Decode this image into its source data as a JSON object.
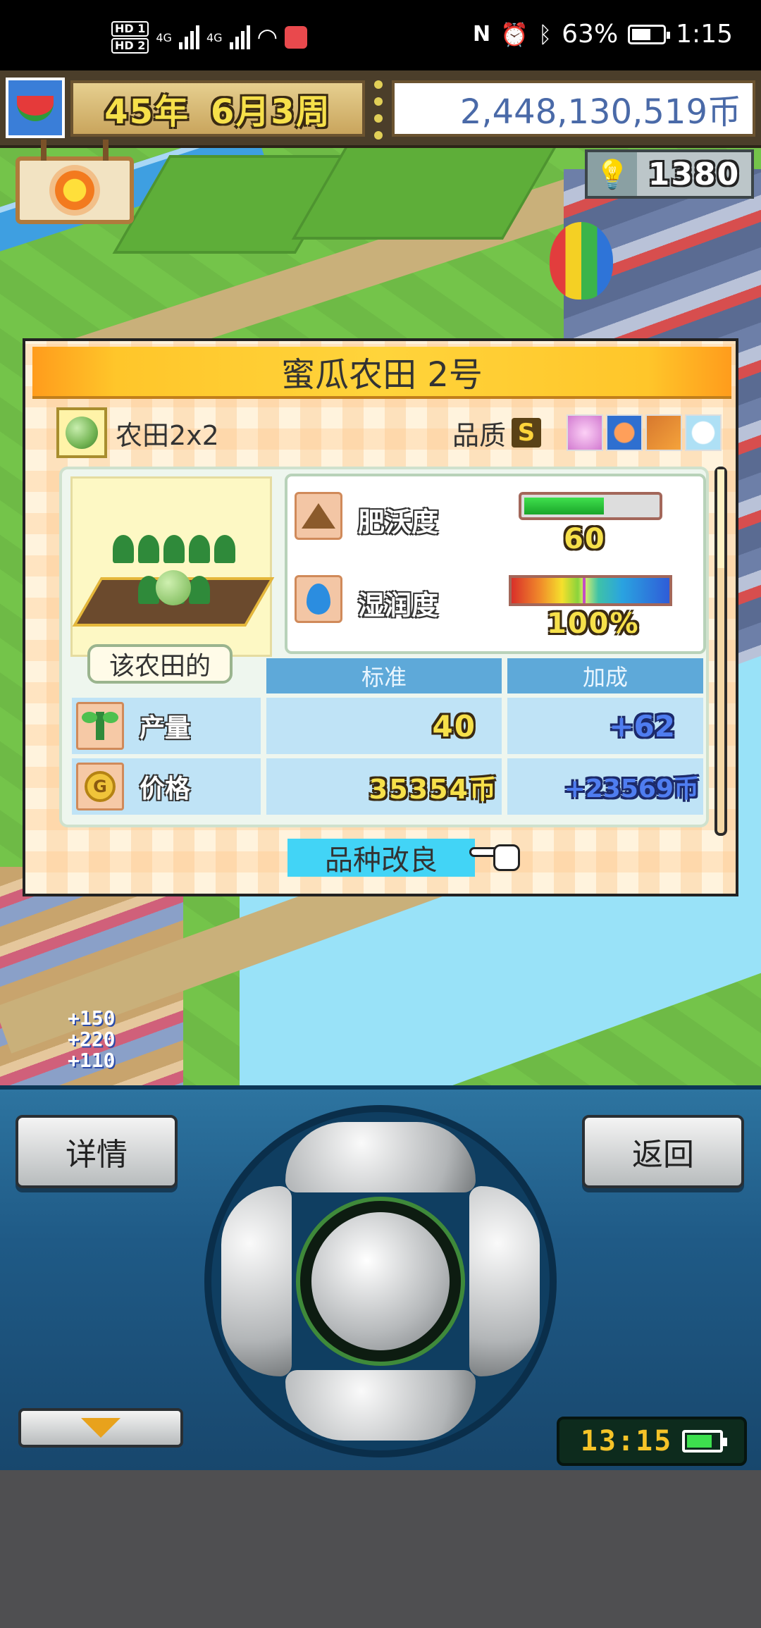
{
  "status_bar": {
    "left_icons": [
      "hd1-icon",
      "hd2-icon",
      "signal-4g-icon",
      "signal-4g-icon",
      "wifi-icon",
      "notification-app-icon"
    ],
    "hd1": "HD 1",
    "hd2": "HD 2",
    "net1": "4G",
    "net2": "4G",
    "right_icons": [
      "nfc-icon",
      "alarm-icon",
      "bluetooth-icon",
      "battery-icon"
    ],
    "battery_percent": "63%",
    "battery_level": 0.63,
    "time": "1:15"
  },
  "hud": {
    "date_year": "45年",
    "date_month_week": "6月3周",
    "money": "2,448,130,519币",
    "idea_points": "1380",
    "weather_icon": "sun-icon"
  },
  "world": {
    "floating_numbers": [
      "+150",
      "+220",
      "+110"
    ]
  },
  "dialog": {
    "title": "蜜瓜农田 2号",
    "field_type": "农田2x2",
    "quality_label": "品质",
    "quality_grade": "S",
    "season_icons": [
      "spring-icon",
      "summer-icon",
      "autumn-icon",
      "winter-icon"
    ],
    "crop_caption": "该农田的",
    "fertility": {
      "label": "肥沃度",
      "value": "60",
      "bar_fraction": 0.6
    },
    "moisture": {
      "label": "湿润度",
      "value": "100%",
      "marker_fraction": 0.45
    },
    "table": {
      "headers": [
        "标准",
        "加成"
      ],
      "rows": [
        {
          "label": "产量",
          "icon": "sprout-icon",
          "standard": "40",
          "bonus": "+62"
        },
        {
          "label": "价格",
          "icon": "gold-coin-icon",
          "standard": "35354币",
          "bonus": "+23569币"
        }
      ]
    },
    "improve_button": "品种改良"
  },
  "controls": {
    "details_button": "详情",
    "back_button": "返回",
    "clock": "13:15",
    "battery_level": 0.8
  },
  "colors": {
    "title_bar": "#ffc62a",
    "improve_button": "#42d4f6",
    "header_blue": "#5ea9d9",
    "gold_number": "#f6e04a"
  }
}
